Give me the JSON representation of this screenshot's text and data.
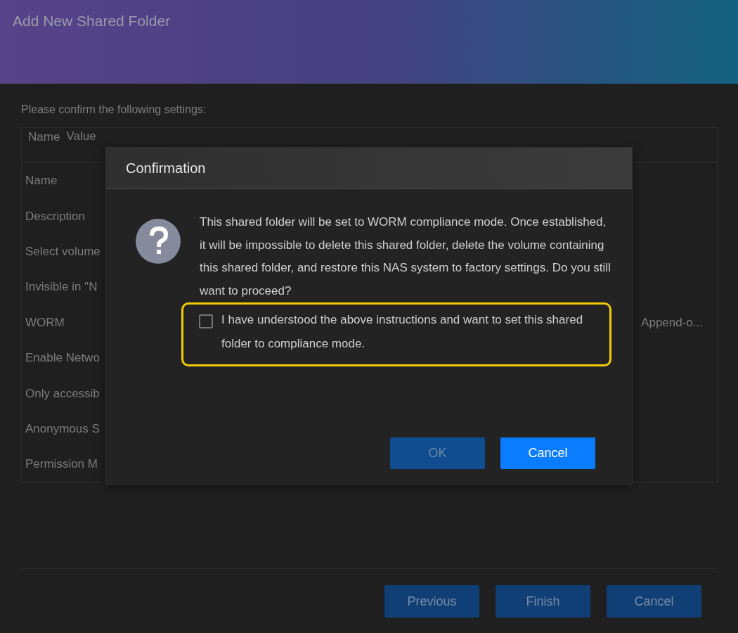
{
  "window": {
    "title": "Add New Shared Folder"
  },
  "intro": "Please confirm the following settings:",
  "table": {
    "columns": [
      "Name",
      "Value"
    ],
    "rows": [
      {
        "name": "Name",
        "value": ""
      },
      {
        "name": "Description",
        "value": ""
      },
      {
        "name": "Select volume",
        "value": ""
      },
      {
        "name": "Invisible in \"N",
        "value": ""
      },
      {
        "name": "WORM",
        "value": "Append-o..."
      },
      {
        "name": "Enable Netwo",
        "value": ""
      },
      {
        "name": "Only accessib",
        "value": ""
      },
      {
        "name": "Anonymous S",
        "value": ""
      },
      {
        "name": "Permission M",
        "value": ""
      }
    ]
  },
  "footer_buttons": [
    {
      "label": "Previous"
    },
    {
      "label": "Finish"
    },
    {
      "label": "Cancel"
    }
  ],
  "dialog": {
    "title": "Confirmation",
    "message": "This shared folder will be set to WORM compliance mode. Once established, it will be impossible to delete this shared folder, delete the volume containing this shared folder, and restore this NAS system to factory settings. Do you still want to proceed?",
    "checkbox": {
      "label": "I have understood the above instructions and want to set this shared folder to compliance mode.",
      "checked": false
    },
    "buttons": [
      {
        "label": "OK",
        "disabled": true
      },
      {
        "label": "Cancel",
        "disabled": false
      }
    ]
  }
}
